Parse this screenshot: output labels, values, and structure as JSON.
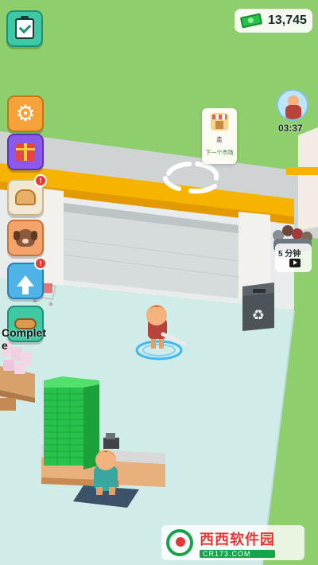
{
  "hud": {
    "money": "13,745",
    "complete_label": "Complete",
    "timer": "03:37",
    "ad_timer_label": "5 分钟",
    "task_card_top": "走",
    "task_card_bottom": "下一个市场",
    "alert_mark": "!"
  },
  "icons": {
    "checklist": "clipboard-check-icon",
    "settings": "gear-icon",
    "gift": "gift-box-icon",
    "bread": "bread-icon",
    "dog": "dog-icon",
    "upgrade": "upgrade-arrow-icon",
    "money": "banknote-stack-icon",
    "recycle": "recycle-icon",
    "video": "video-play-icon"
  },
  "watermark": {
    "brand": "西西软件园",
    "url": "CR173.COM"
  },
  "colors": {
    "grass": "#8fce6c",
    "floor": "#cfece9",
    "wall_stripe": "#f6b400",
    "cash": "#27c24a",
    "orange_button": "#f5a23b",
    "purple_button": "#8c5ae8",
    "teal_button": "#3ec8a4"
  }
}
